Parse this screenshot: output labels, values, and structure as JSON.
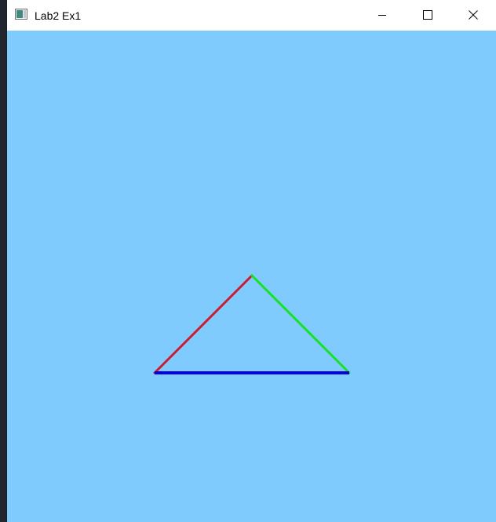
{
  "window": {
    "title": "Lab2 Ex1",
    "icon": "app-window-icon",
    "controls": {
      "minimize_icon": "minimize-icon",
      "maximize_icon": "maximize-icon",
      "close_icon": "close-icon"
    }
  },
  "scene": {
    "background_color": "#80cbfe",
    "triangle": {
      "left_edge_color": "#d01a2e",
      "right_edge_color": "#18e025",
      "base_edge_color": "#0000e0"
    }
  }
}
